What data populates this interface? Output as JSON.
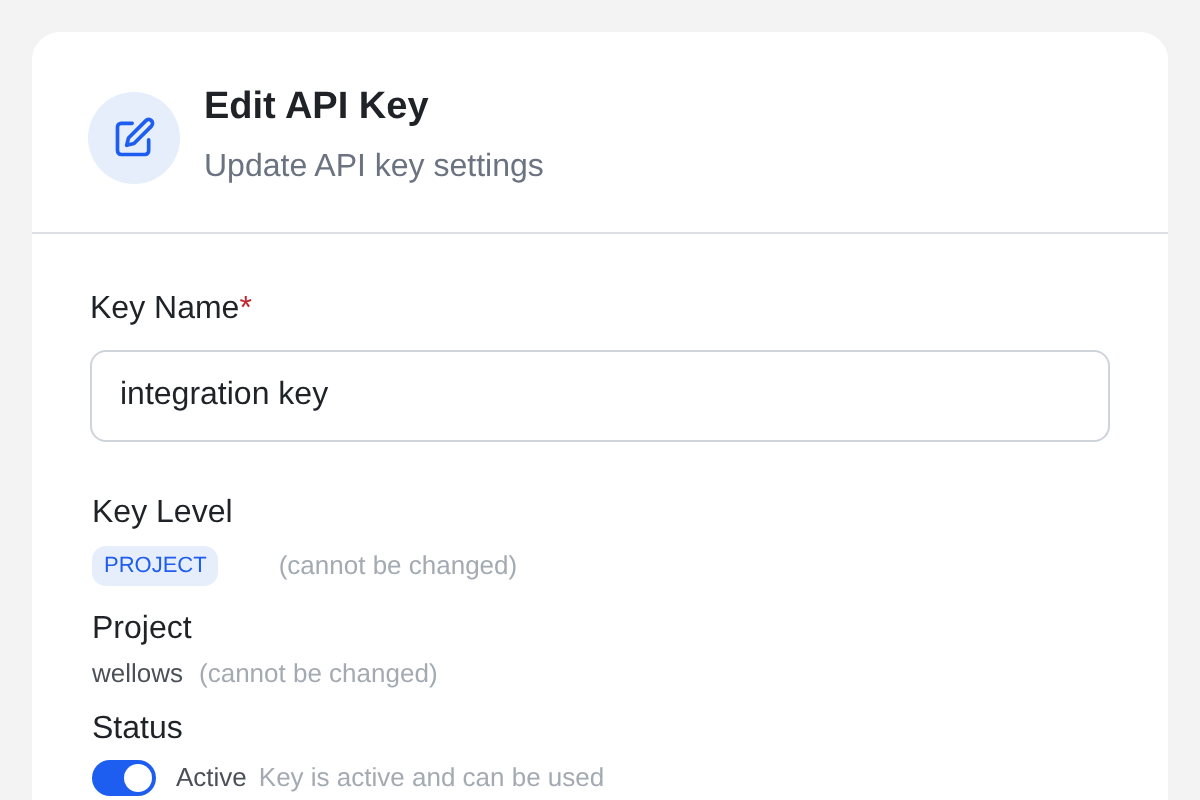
{
  "header": {
    "title": "Edit API Key",
    "subtitle": "Update API key settings"
  },
  "key_name": {
    "label": "Key Name",
    "required_mark": "*",
    "value": "integration key"
  },
  "key_level": {
    "label": "Key Level",
    "badge": "PROJECT",
    "note": "(cannot be changed)"
  },
  "project": {
    "label": "Project",
    "value": "wellows",
    "note": "(cannot be changed)"
  },
  "status": {
    "label": "Status",
    "on": true,
    "state_label": "Active",
    "description": "Key is active and can be used"
  }
}
